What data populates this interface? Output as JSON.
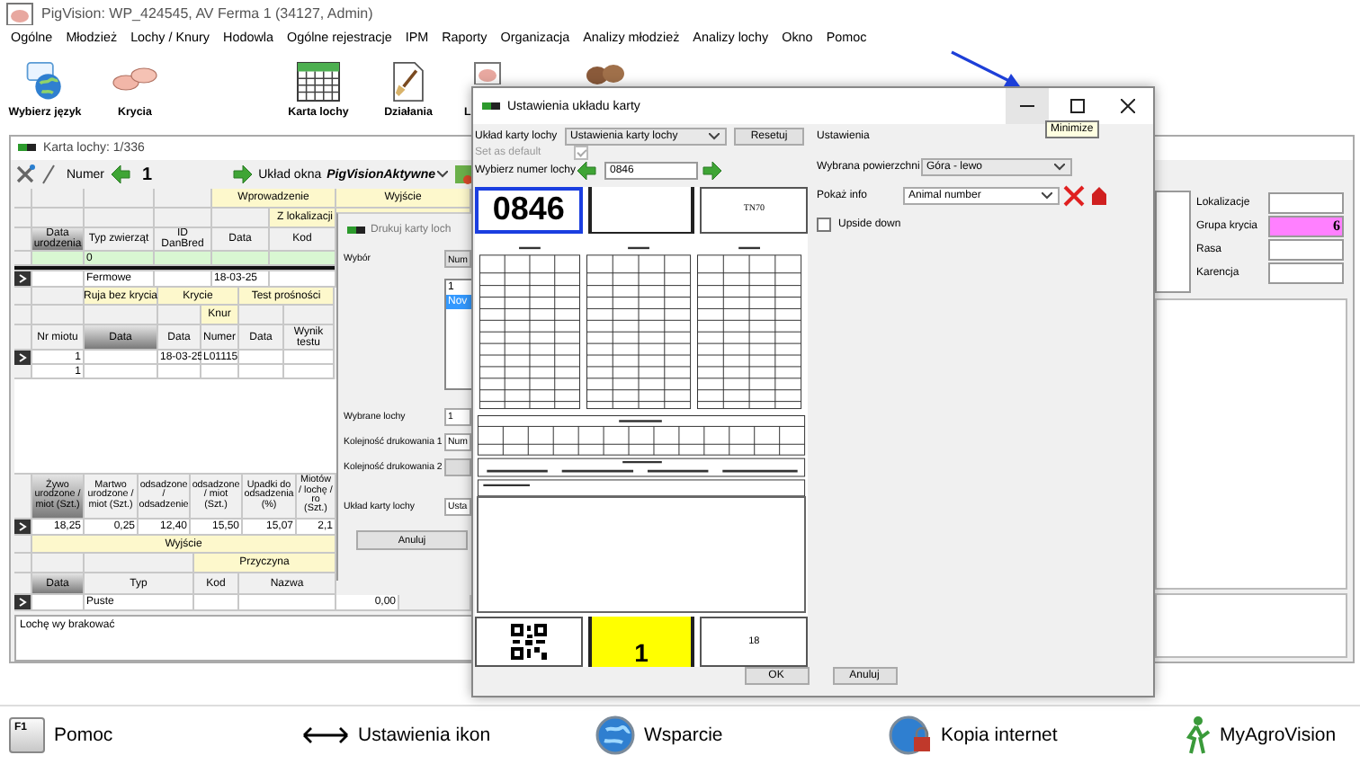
{
  "window": {
    "title": "PigVision: WP_424545, AV Ferma 1 (34127, Admin)"
  },
  "menu": [
    "Ogólne",
    "Młodzież",
    "Lochy / Knury",
    "Hodowla",
    "Ogólne rejestracje",
    "IPM",
    "Raporty",
    "Organizacja",
    "Analizy młodzież",
    "Analizy lochy",
    "Okno",
    "Pomoc"
  ],
  "toolbar": [
    {
      "label": "Wybierz język",
      "kind": "globe"
    },
    {
      "label": "Krycia",
      "kind": "pigs"
    },
    {
      "label": "Karta lochy",
      "kind": "calendar"
    },
    {
      "label": "Działania",
      "kind": "brush"
    },
    {
      "label": "L",
      "kind": "pig"
    },
    {
      "kind": "animals"
    }
  ],
  "sow_card": {
    "title": "Karta lochy: 1/336",
    "toolbar": {
      "number_label": "Numer",
      "number": "1",
      "layout_label": "Układ okna",
      "layout_value": "PigVisionAktywne"
    },
    "animal_table": {
      "groups": [
        "Wprowadzenie",
        "Wyjście"
      ],
      "subgroups": [
        "Z lokalizacji"
      ],
      "columns": [
        {
          "label": "Data urodzenia",
          "sorted": true
        },
        {
          "label": "Typ zwierząt",
          "sorted": false
        },
        {
          "label": "ID DanBred",
          "sorted": false
        },
        {
          "label": "Data",
          "sorted": false
        },
        {
          "label": "Kod",
          "sorted": false
        }
      ],
      "new_row": {
        "column_2": "0"
      },
      "rows": [
        {
          "cells": {
            "column_2": "Fermowe",
            "column_4": "18-03-25"
          },
          "selected": true
        }
      ]
    },
    "litter_table": {
      "groups": [
        "Ruja bez krycia",
        "Krycie",
        "Test prośności"
      ],
      "subgroups": [
        "Knur"
      ],
      "columns": [
        {
          "label": "Nr miotu",
          "sorted": false
        },
        {
          "label": "Data",
          "sorted": true
        },
        {
          "label": "Data",
          "sorted": false
        },
        {
          "label": "Numer",
          "sorted": false
        },
        {
          "label": "Data",
          "sorted": false
        },
        {
          "label": "Wynik testu",
          "sorted": false
        }
      ],
      "rows": [
        {
          "cells": {
            "column_1": "1",
            "column_3": "18-03-25",
            "column_4": "L01115"
          },
          "selected": true
        },
        {
          "cells": {
            "column_1": "1"
          },
          "selected": false
        }
      ]
    },
    "stats_table": {
      "columns": [
        {
          "label": "Żywo urodzone / miot (Szt.)",
          "sorted": true
        },
        {
          "label": "Martwo urodzone / miot (Szt.)",
          "sorted": false
        },
        {
          "label": "odsadzone / odsadzenie",
          "sorted": false
        },
        {
          "label": "odsadzone / miot (Szt.)",
          "sorted": false
        },
        {
          "label": "Upadki do odsadzenia (%)",
          "sorted": false
        },
        {
          "label": "Miotów / lochę / ro (Szt.)",
          "sorted": false
        }
      ],
      "rows": [
        {
          "cells": {
            "column_1": "18,25",
            "column_2": "0,25",
            "column_3": "12,40",
            "column_4": "15,50",
            "column_5": "15,07",
            "column_6": "2,1"
          },
          "selected": true
        }
      ]
    },
    "exit_table": {
      "groups": [
        "Wyjście"
      ],
      "subgroups": [
        "Przyczyna"
      ],
      "columns": [
        {
          "label": "Data",
          "sorted": true
        },
        {
          "label": "Typ",
          "sorted": false
        },
        {
          "label": "Kod",
          "sorted": false
        },
        {
          "label": "Nazwa",
          "sorted": false
        }
      ],
      "rows": [
        {
          "cells": {
            "column_2": "Puste",
            "column_5": "0,00"
          },
          "selected": true
        }
      ]
    },
    "note": "Lochę wy brakować",
    "fields": [
      {
        "label": "Lokalizacje"
      },
      {
        "label": "Grupa krycia",
        "value": "6",
        "color": "#ff80ff"
      },
      {
        "label": "Rasa"
      },
      {
        "label": "Karencja"
      }
    ]
  },
  "print_dialog": {
    "title": "Drukuj karty loch",
    "selection_label": "Wybór",
    "selection_button": "Num",
    "list": [
      {
        "label": "1",
        "selected": false
      },
      {
        "label": "Nov",
        "selected": true
      }
    ],
    "selected_sows_label": "Wybrane lochy",
    "selected_sows": "1",
    "order1_label": "Kolejność drukowania 1",
    "order1": "Num",
    "order2_label": "Kolejność drukowania 2",
    "layout_label": "Układ karty lochy",
    "layout": "Usta",
    "cancel": "Anuluj"
  },
  "layout_dialog": {
    "title": "Ustawienia układu karty",
    "tooltip": "Minimize",
    "layout_label": "Układ karty lochy",
    "layout_value": "Ustawienia karty lochy",
    "reset": "Resetuj",
    "default_label": "Set as default",
    "default_checked": true,
    "sow_label": "Wybierz numer lochy",
    "sow_number": "0846",
    "preview": {
      "number": "0846",
      "breed": "TN70",
      "group": "1",
      "value": "18"
    },
    "settings_label": "Ustawienia",
    "area_label": "Wybrana powierzchni",
    "area_value": "Góra - lewo",
    "info_label": "Pokaż info",
    "info_value": "Animal number",
    "upside_label": "Upside down",
    "upside_down": false,
    "ok": "OK",
    "cancel": "Anuluj"
  },
  "footer": [
    {
      "label": "Pomoc",
      "kind": "key",
      "key": "F1"
    },
    {
      "label": "Ustawienia ikon",
      "kind": "arrows"
    },
    {
      "label": "Wsparcie",
      "kind": "globe"
    },
    {
      "label": "Kopia internet",
      "kind": "backup"
    },
    {
      "label": "MyAgroVision",
      "kind": "person"
    }
  ]
}
